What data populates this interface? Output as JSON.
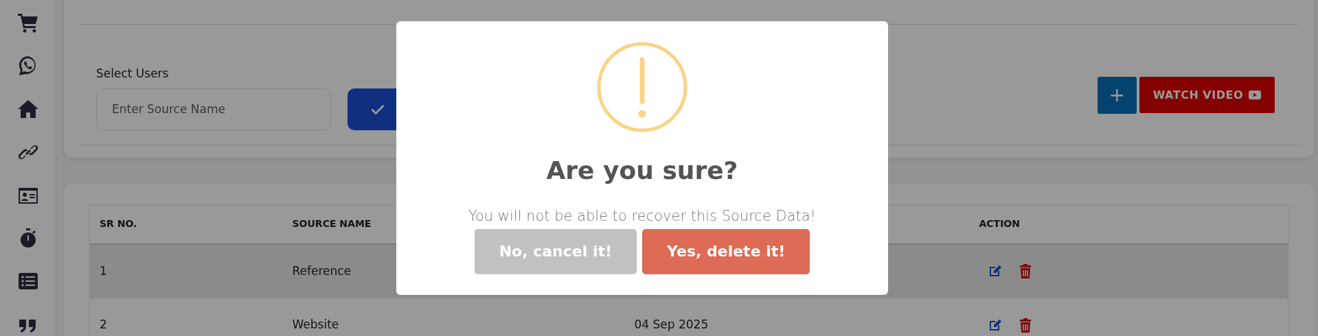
{
  "filter_card": {
    "label": "Select Users",
    "input": {
      "placeholder": "Enter Source Name"
    },
    "add_button": "+",
    "video_button": "WATCH VIDEO"
  },
  "table": {
    "columns": [
      {
        "label": "SR NO."
      },
      {
        "label": "SOURCE NAME"
      },
      {},
      {
        "label": "ACTION"
      }
    ],
    "rows": [
      {
        "sr_no": "1",
        "source_name": "Reference",
        "selected": true
      },
      {
        "sr_no": "2",
        "source_name": "Website",
        "column_3": "04 Sep 2025",
        "selected": false
      }
    ]
  },
  "dialog": {
    "title": "Are you sure?",
    "text": "You will not be able to recover this Source Data!",
    "buttons": [
      {
        "label": "No, cancel it!",
        "kind": "cancel"
      },
      {
        "label": "Yes, delete it!",
        "kind": "confirm"
      }
    ]
  }
}
